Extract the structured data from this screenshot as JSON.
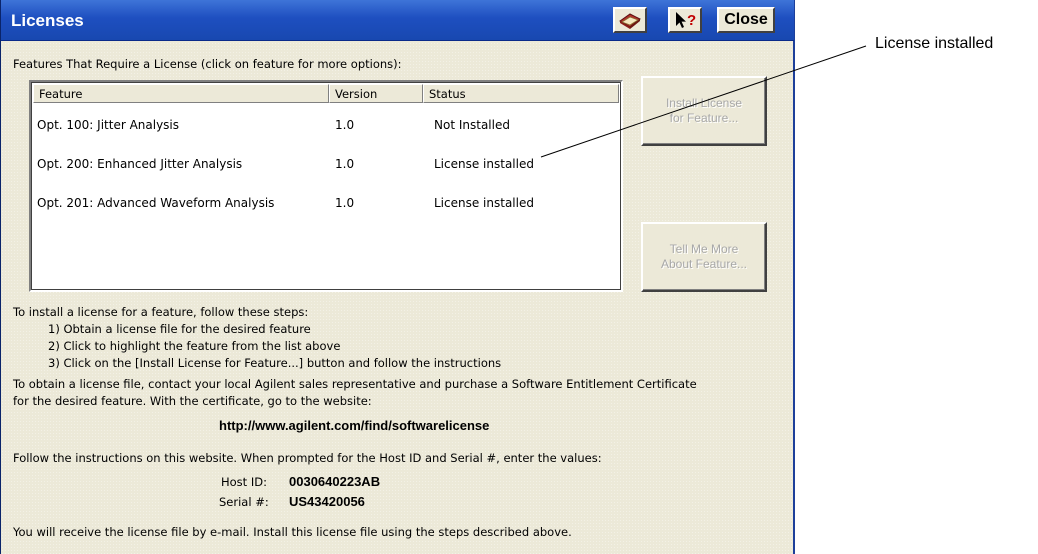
{
  "window": {
    "title": "Licenses",
    "book_icon": "book-icon",
    "help_icon": "whats-this-help-icon",
    "close_label": "Close"
  },
  "features_label": "Features That Require a License (click on feature for more options):",
  "table": {
    "columns": [
      "Feature",
      "Version",
      "Status"
    ],
    "rows": [
      {
        "feature": "Opt. 100: Jitter Analysis",
        "version": "1.0",
        "status": "Not Installed"
      },
      {
        "feature": "Opt. 200: Enhanced Jitter Analysis",
        "version": "1.0",
        "status": "License installed"
      },
      {
        "feature": "Opt. 201: Advanced Waveform Analysis",
        "version": "1.0",
        "status": "License installed"
      }
    ]
  },
  "buttons": {
    "install_line1": "Install License",
    "install_line2": "for Feature...",
    "tell_line1": "Tell Me More",
    "tell_line2": "About Feature..."
  },
  "instructions": {
    "intro": "To install a license for a feature, follow these steps:",
    "step1": "1) Obtain a license file for the desired feature",
    "step2": "2) Click to highlight the feature from the list above",
    "step3": "3) Click on the [Install License for Feature...] button and follow the instructions",
    "obtain_line1": "To obtain a license file, contact your local Agilent sales representative and purchase a Software Entitlement Certificate",
    "obtain_line2": "for the desired feature.  With the certificate, go to the website:",
    "url": "http://www.agilent.com/find/softwarelicense",
    "follow": "Follow the instructions on this website.  When prompted for the Host ID and Serial #, enter the values:",
    "host_id_label": "Host ID:",
    "host_id_value": "0030640223AB",
    "serial_label": "Serial #:",
    "serial_value": "US43420056",
    "email": "You will receive the license file by e-mail.  Install this license file using the steps described above."
  },
  "callout": {
    "label": "License installed"
  }
}
